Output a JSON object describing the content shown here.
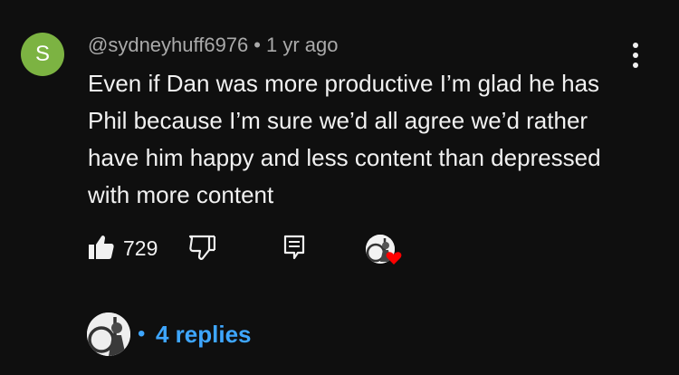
{
  "comment": {
    "avatar_letter": "S",
    "avatar_color": "#7cb342",
    "username": "@sydneyhuff6976",
    "separator": "•",
    "timestamp": "1 yr ago",
    "text": "Even if Dan was more productive I’m glad he has Phil because I’m sure we’d all agree we’d rather have him happy and less content than depressed with more content",
    "like_count": "729",
    "icons": {
      "more": "more-vertical-icon",
      "like": "thumbs-up-icon",
      "dislike": "thumbs-down-icon",
      "reply": "reply-icon",
      "creator_heart": "heart-icon"
    }
  },
  "replies": {
    "separator": "•",
    "label": "4 replies",
    "color": "#3ea6ff"
  },
  "theme": {
    "background": "#0f0f0f",
    "text": "#f1f1f1",
    "secondary_text": "#aaaaaa",
    "heart": "#ff0000"
  }
}
